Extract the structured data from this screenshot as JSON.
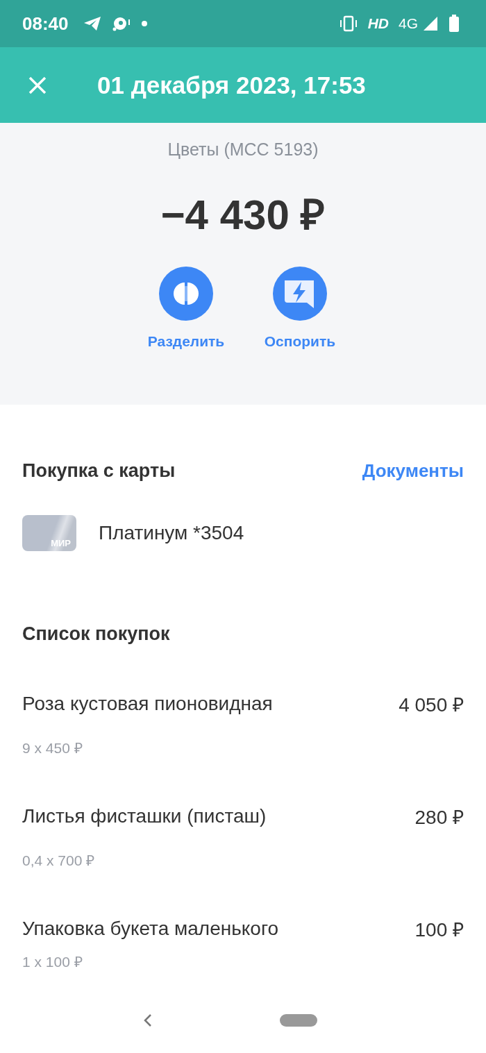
{
  "status_bar": {
    "time": "08:40",
    "network": "HD",
    "signal_type": "4G"
  },
  "header": {
    "title": "01 декабря 2023, 17:53"
  },
  "summary": {
    "category": "Цветы (MCC 5193)",
    "amount": "−4 430 ₽",
    "actions": [
      {
        "label": "Разделить",
        "kind": "split"
      },
      {
        "label": "Оспорить",
        "kind": "dispute"
      }
    ]
  },
  "payment": {
    "title": "Покупка с карты",
    "documents_link": "Документы",
    "card_brand": "МИР",
    "card_name": "Платинум *3504"
  },
  "purchases": {
    "title": "Список покупок",
    "items": [
      {
        "name": "Роза кустовая пионовидная",
        "price": "4 050 ₽",
        "detail": "9 x 450 ₽"
      },
      {
        "name": "Листья фисташки (писташ)",
        "price": "280 ₽",
        "detail": "0,4 x 700 ₽"
      },
      {
        "name": "Упаковка букета маленького",
        "price": "100 ₽",
        "detail": "1 x 100 ₽"
      }
    ]
  }
}
